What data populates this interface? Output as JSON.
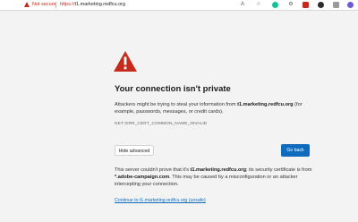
{
  "address_bar": {
    "security_label": "Not secure",
    "url_scheme": "https://",
    "url_host": "t1.marketing.redfcu.org"
  },
  "toolbar": {
    "read_aloud_label": "A",
    "icons": [
      "read-aloud-icon",
      "favorite-icon",
      "grammarly-icon",
      "extension-icon",
      "extension-red-icon",
      "extension-dark-icon",
      "extension-gray-icon",
      "extension-purple-icon"
    ]
  },
  "page": {
    "title": "Your connection isn't private",
    "desc_prefix": "Attackers might be trying to steal your information from ",
    "desc_host": "t1.marketing.redfcu.org",
    "desc_suffix": " (for example, passwords, messages, or credit cards).",
    "error_code": "NET::ERR_CERT_COMMON_NAME_INVALID",
    "hide_advanced_label": "Hide advanced",
    "go_back_label": "Go back",
    "advanced_prefix": "This server couldn't prove that it's ",
    "advanced_host": "t1.marketing.redfcu.org",
    "advanced_middle": "; its security certificate is from ",
    "advanced_cert": "*.adobe-campaign.com",
    "advanced_suffix": ". This may be caused by a misconfiguration or an attacker intercepting your connection.",
    "continue_link": "Continue to t1.marketing.redfcu.org (unsafe)"
  },
  "colors": {
    "warning_red": "#c42b1c",
    "accent_blue": "#0f6cbd"
  }
}
